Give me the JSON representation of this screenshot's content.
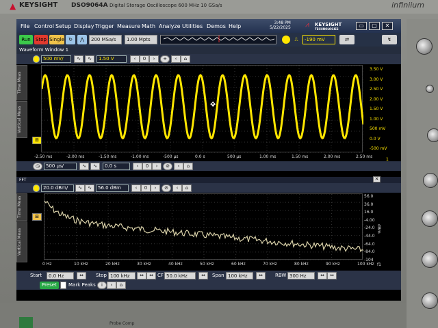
{
  "brand": {
    "name": "KEYSIGHT",
    "model": "DSO9064A",
    "description": "Digital Storage Oscilloscope   600 MHz   10 GSa/s",
    "series": "infiniium"
  },
  "menu": [
    "File",
    "Control",
    "Setup",
    "Display",
    "Trigger",
    "Measure",
    "Math",
    "Analyze",
    "Utilities",
    "Demos",
    "Help"
  ],
  "datetime": {
    "time": "3:48 PM",
    "date": "5/22/2025"
  },
  "logo": {
    "name": "KEYSIGHT",
    "sub": "TECHNOLOGIES"
  },
  "toolbar": {
    "run": "Run",
    "stop": "Stop",
    "single": "Single",
    "sample_rate": "200 MSa/s",
    "memory": "1.00 Mpts",
    "trigger_level": "-190 mV"
  },
  "waveform_window": {
    "title": "Waveform Window 1",
    "scale": "500 mV/",
    "offset": "1.50 V",
    "yticks": [
      "3.50 V",
      "3.00 V",
      "2.50 V",
      "2.00 V",
      "1.50 V",
      "1.00 V",
      "500 mV",
      "0.0 V",
      "-500 mV"
    ],
    "xticks": [
      "-2.50 ms",
      "-2.00 ms",
      "-1.50 ms",
      "-1.00 ms",
      "-500 µs",
      "0.0 s",
      "500 µs",
      "1.00 ms",
      "1.50 ms",
      "2.00 ms",
      "2.50 ms"
    ],
    "channel_num": "1"
  },
  "timebase": {
    "scale": "500 µs/",
    "position": "0.0 s"
  },
  "fft": {
    "title": "FFT",
    "scale": "20.0 dBm/",
    "offset": "56.0 dBm",
    "yticks": [
      "56.0",
      "36.0",
      "16.0",
      "-4.00",
      "-24.0",
      "-44.0",
      "-64.0",
      "-84.0",
      "-104"
    ],
    "yunit": "dBm",
    "xticks": [
      "0 Hz",
      "10 kHz",
      "20 kHz",
      "30 kHz",
      "40 kHz",
      "50 kHz",
      "60 kHz",
      "70 kHz",
      "80 kHz",
      "90 kHz",
      "100 kHz"
    ],
    "func": "f1"
  },
  "fft_controls": {
    "start_label": "Start",
    "start": "0.0 Hz",
    "stop_label": "Stop",
    "stop": "100 kHz",
    "cf_label": "CF",
    "cf": "50.0 kHz",
    "span_label": "Span",
    "span": "100 kHz",
    "rbw_label": "RBW",
    "rbw": "300 Hz",
    "preset": "Preset",
    "mark_peaks": "Mark Peaks"
  },
  "side_tabs": {
    "time_meas": "Time Meas",
    "vertical_meas": "Vertical Meas"
  },
  "bottom_label": "Probe Comp",
  "colors": {
    "channel1": "#ffe600",
    "fft": "#d8d0a8"
  }
}
